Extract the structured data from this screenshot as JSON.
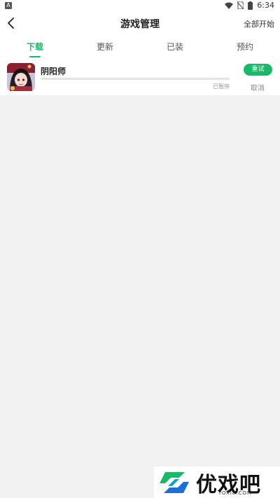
{
  "status_bar": {
    "time": "6:34",
    "icons": [
      "notification-a-icon",
      "wifi-icon",
      "no-sim-icon",
      "battery-icon"
    ]
  },
  "header": {
    "title": "游戏管理",
    "action_label": "全部开始"
  },
  "tabs": [
    {
      "label": "下载",
      "active": true
    },
    {
      "label": "更新",
      "active": false
    },
    {
      "label": "已装",
      "active": false
    },
    {
      "label": "预约",
      "active": false
    }
  ],
  "downloads": [
    {
      "name": "阴阳师",
      "status": "已暂停",
      "progress": 0,
      "retry_label": "重试",
      "cancel_label": "取消"
    }
  ],
  "watermark": {
    "brand": "优戏吧",
    "domain": "YOXI8.COM"
  },
  "colors": {
    "accent": "#1bb86a",
    "background": "#f2f2f2"
  }
}
